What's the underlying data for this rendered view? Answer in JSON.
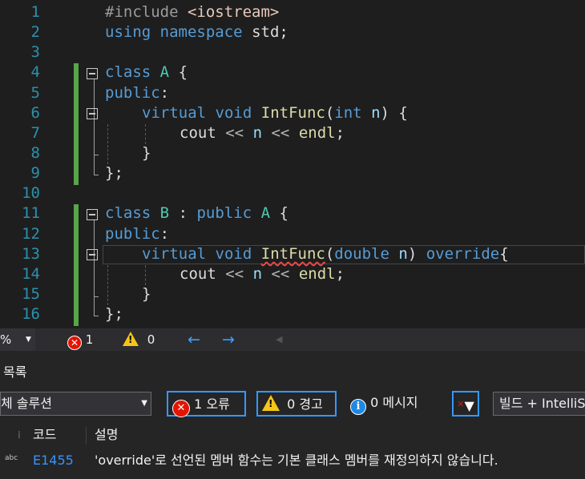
{
  "editor": {
    "lines": [
      {
        "num": "1"
      },
      {
        "num": "2"
      },
      {
        "num": "3"
      },
      {
        "num": "4"
      },
      {
        "num": "5"
      },
      {
        "num": "6"
      },
      {
        "num": "7"
      },
      {
        "num": "8"
      },
      {
        "num": "9"
      },
      {
        "num": "10"
      },
      {
        "num": "11"
      },
      {
        "num": "12"
      },
      {
        "num": "13"
      },
      {
        "num": "14"
      },
      {
        "num": "15"
      },
      {
        "num": "16"
      }
    ],
    "code": {
      "l1_pp": "#include",
      "l1_inc": "<iostream>",
      "l2_kw1": "using",
      "l2_kw2": "namespace",
      "l2_rest": "std;",
      "l4_kw": "class",
      "l4_ty": "A",
      "l4_brace": "{",
      "l5_kw": "public",
      "l5_colon": ":",
      "l6_kw1": "virtual",
      "l6_kw2": "void",
      "l6_fn": "IntFunc",
      "l6_p1": "(",
      "l6_kw3": "int",
      "l6_prm": "n",
      "l6_p2": ") {",
      "l7_a": "cout",
      "l7_op1": "<<",
      "l7_prm": "n",
      "l7_op2": "<<",
      "l7_fn": "endl",
      "l7_semi": ";",
      "l8": "}",
      "l9": "};",
      "l11_kw": "class",
      "l11_ty": "B",
      "l11_colon": ":",
      "l11_kw2": "public",
      "l11_ty2": "A",
      "l11_brace": "{",
      "l12_kw": "public",
      "l12_colon": ":",
      "l13_kw1": "virtual",
      "l13_kw2": "void",
      "l13_fn": "IntFunc",
      "l13_p1": "(",
      "l13_kw3": "double",
      "l13_prm": "n",
      "l13_p2": ")",
      "l13_kw4": "override",
      "l13_brace": "{",
      "l14_a": "cout",
      "l14_op1": "<<",
      "l14_prm": "n",
      "l14_op2": "<<",
      "l14_fn": "endl",
      "l14_semi": ";",
      "l15": "}",
      "l16": "};"
    }
  },
  "status": {
    "zoom": "%",
    "errors": "1",
    "warnings": "0",
    "back_arrow": "←",
    "forward_arrow": "→",
    "play_marker": "◀"
  },
  "error_list": {
    "title": "목록",
    "scope": "체 솔루션",
    "errors_button": "1 오류",
    "warnings_button": "0 경고",
    "messages_button": "0 메시지",
    "source": "빌드 + IntelliS",
    "columns": {
      "code": "코드",
      "description": "설명"
    },
    "rows": [
      {
        "type_icon": "abc",
        "code": "E1455",
        "description": "'override'로 선언된 멤버 함수는 기본 클래스 멤버를 재정의하지 않습니다."
      }
    ]
  },
  "colors": {
    "accent": "#3399ff",
    "error": "#e51400",
    "warning": "#f5c518",
    "gutter_change": "#57a64a",
    "line_number": "#2b91af"
  }
}
